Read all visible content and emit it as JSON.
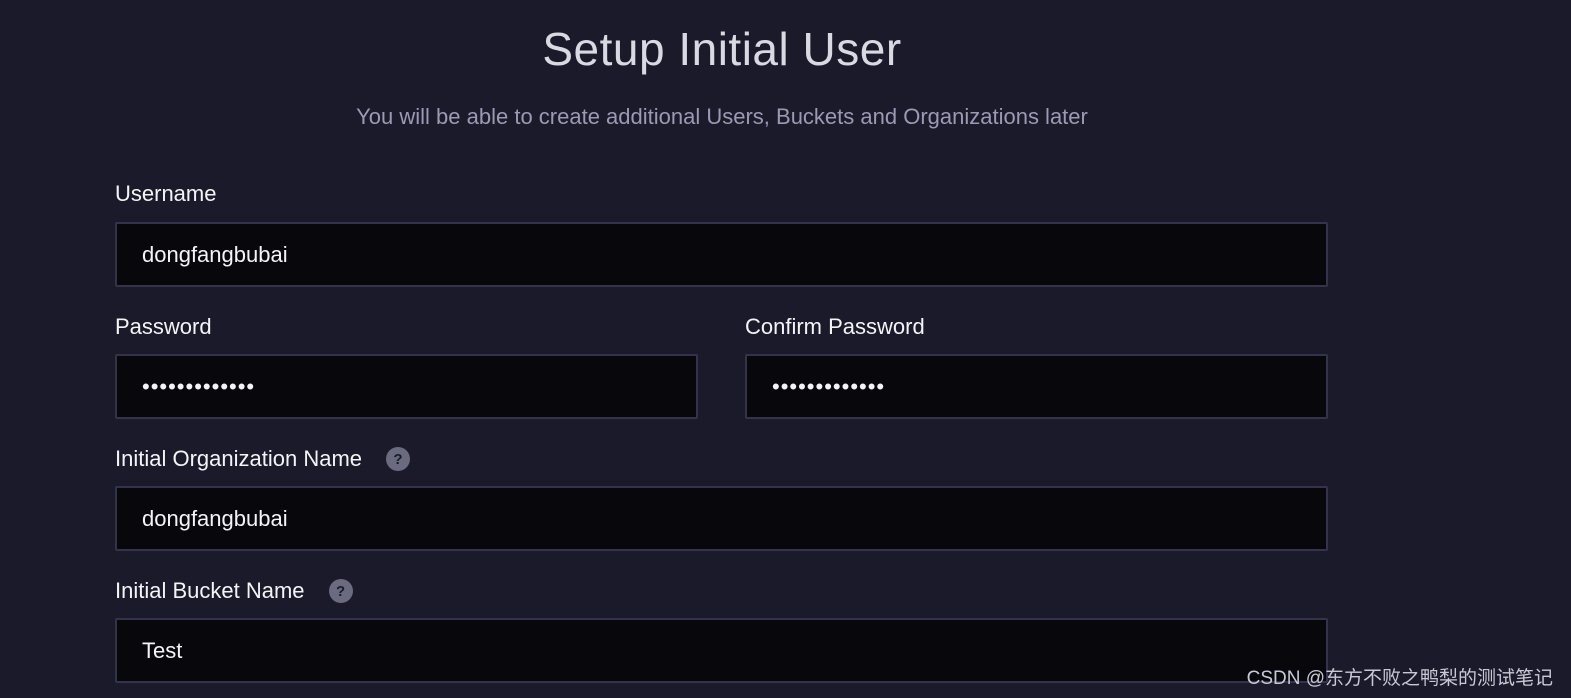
{
  "header": {
    "title": "Setup Initial User",
    "subtitle": "You will be able to create additional Users, Buckets and Organizations later"
  },
  "form": {
    "username": {
      "label": "Username",
      "value": "dongfangbubai"
    },
    "password": {
      "label": "Password",
      "value": "•••••••••••••"
    },
    "confirm_password": {
      "label": "Confirm Password",
      "value": "•••••••••••••"
    },
    "org_name": {
      "label": "Initial Organization Name",
      "value": "dongfangbubai",
      "help": "?"
    },
    "bucket_name": {
      "label": "Initial Bucket Name",
      "value": "Test",
      "help": "?"
    }
  },
  "watermark": "CSDN @东方不败之鸭梨的测试笔记",
  "icons": {
    "help": "question-mark-circle-icon"
  },
  "colors": {
    "background": "#1b1a2a",
    "field_background": "#07070c",
    "field_border": "#33334a"
  }
}
